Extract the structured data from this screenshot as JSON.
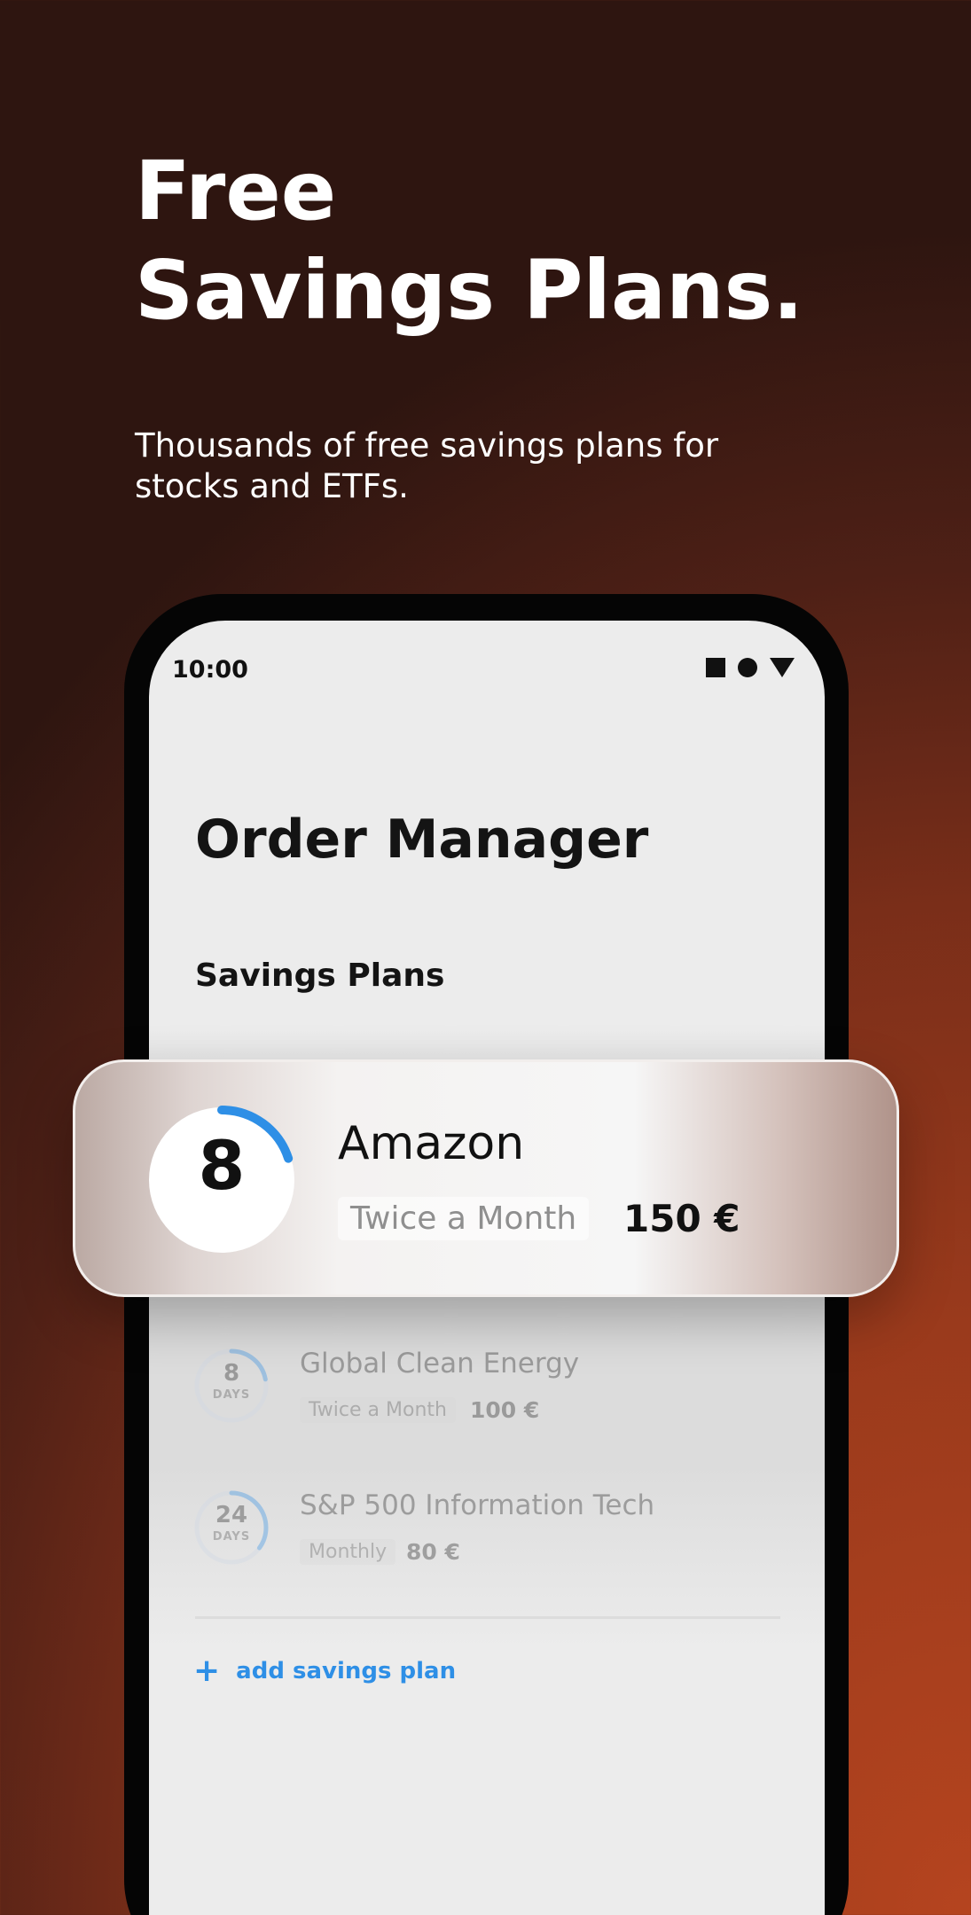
{
  "promo": {
    "title_line1": "Free",
    "title_line2": "Savings Plans.",
    "subtitle": "Thousands of free savings plans for stocks and ETFs."
  },
  "status_bar": {
    "time": "10:00",
    "icons": [
      "square-icon",
      "circle-icon",
      "triangle-icon"
    ]
  },
  "screen": {
    "title": "Order Manager",
    "section_title": "Savings Plans"
  },
  "highlighted_plan": {
    "days": "8",
    "name": "Amazon",
    "frequency": "Twice a Month",
    "amount": "150 €",
    "progress": 0.2
  },
  "plans": [
    {
      "days": "8",
      "days_label": "DAYS",
      "name": "Global Clean Energy",
      "frequency": "Twice a Month",
      "amount": "100 €",
      "progress": 0.22
    },
    {
      "days": "24",
      "days_label": "DAYS",
      "name": "S&P 500 Information Tech",
      "frequency": "Monthly",
      "amount": "80 €",
      "progress": 0.35
    }
  ],
  "add_link": {
    "icon": "plus-icon",
    "label": "add savings plan"
  },
  "colors": {
    "accent": "#2e8fe6",
    "background_start": "#2e1510",
    "background_end": "#b5441f"
  }
}
